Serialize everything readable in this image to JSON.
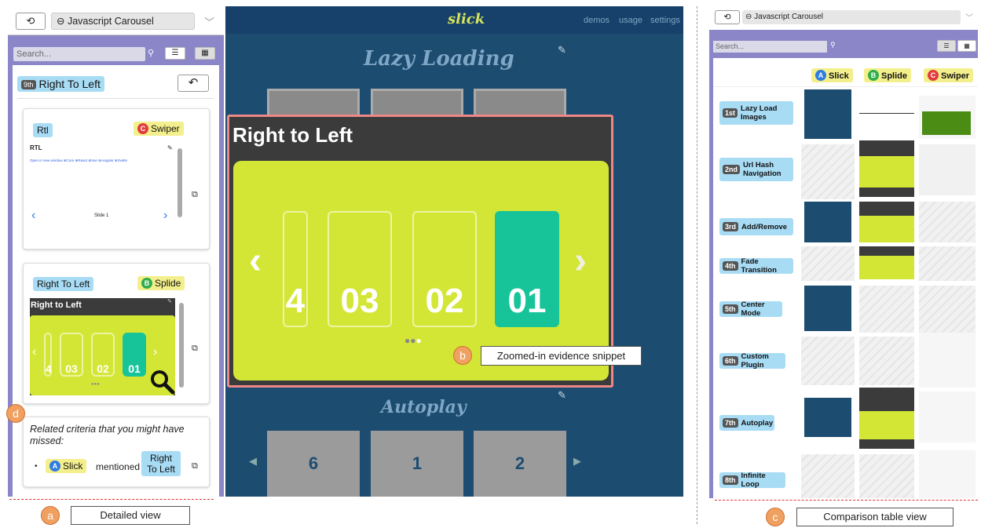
{
  "left": {
    "history_icon": "history-icon",
    "dropdown_value": "Javascript Carousel",
    "search_placeholder": "Search...",
    "criterion": {
      "order": "9th",
      "label": "Right To Left"
    },
    "card1": {
      "criterion_tag": "Rtl",
      "library": "Swiper",
      "library_letter": "C",
      "snippet_title": "RTL",
      "snippet_links": "Open in new window  ⊕Core ⊕React ⊕Vue ⊕Angular ⊕Svelte",
      "slide_text": "Slide 1"
    },
    "card2": {
      "criterion_tag": "Right To Left",
      "library": "Splide",
      "library_letter": "B",
      "snippet_title": "Right to Left",
      "slides": [
        "4",
        "03",
        "02",
        "01"
      ]
    },
    "related": {
      "title": "Related criteria that you might have missed:",
      "library": "Slick",
      "library_letter": "A",
      "mentioned": "mentioned",
      "criterion": "Right To Left"
    }
  },
  "mid": {
    "logo": "slick",
    "nav": [
      "demos",
      "usage",
      "settings"
    ],
    "section_top": "Lazy Loading",
    "zoom_title": "Right to Left",
    "zoom_slides": [
      "4",
      "03",
      "02",
      "01"
    ],
    "section_bottom": "Autoplay",
    "bottom_slides": [
      "6",
      "1",
      "2"
    ]
  },
  "right": {
    "dropdown_value": "Javascript Carousel",
    "search_placeholder": "Search...",
    "columns": [
      {
        "letter": "A",
        "name": "Slick"
      },
      {
        "letter": "B",
        "name": "Splide"
      },
      {
        "letter": "C",
        "name": "Swiper"
      }
    ],
    "rows": [
      {
        "order": "1st",
        "label": "Lazy Load Images"
      },
      {
        "order": "2nd",
        "label": "Url Hash Navigation"
      },
      {
        "order": "3rd",
        "label": "Add/Remove"
      },
      {
        "order": "4th",
        "label": "Fade Transition"
      },
      {
        "order": "5th",
        "label": "Center Mode"
      },
      {
        "order": "6th",
        "label": "Custom Plugin"
      },
      {
        "order": "7th",
        "label": "Autoplay"
      },
      {
        "order": "8th",
        "label": "Infinite Loop"
      }
    ]
  },
  "callouts": {
    "a": {
      "letter": "a",
      "label": "Detailed view"
    },
    "b": {
      "letter": "b",
      "label": "Zoomed-in evidence snippet"
    },
    "c": {
      "letter": "c",
      "label": "Comparison table view"
    },
    "d": {
      "letter": "d"
    }
  },
  "colors": {
    "panel": "#8a86c8",
    "criterion_tag": "#a8dcf5",
    "library_tag": "#f3ef8c",
    "slide_lime": "#d4e635",
    "slide_teal": "#17c49a",
    "dark_blue": "#1c4c70"
  }
}
